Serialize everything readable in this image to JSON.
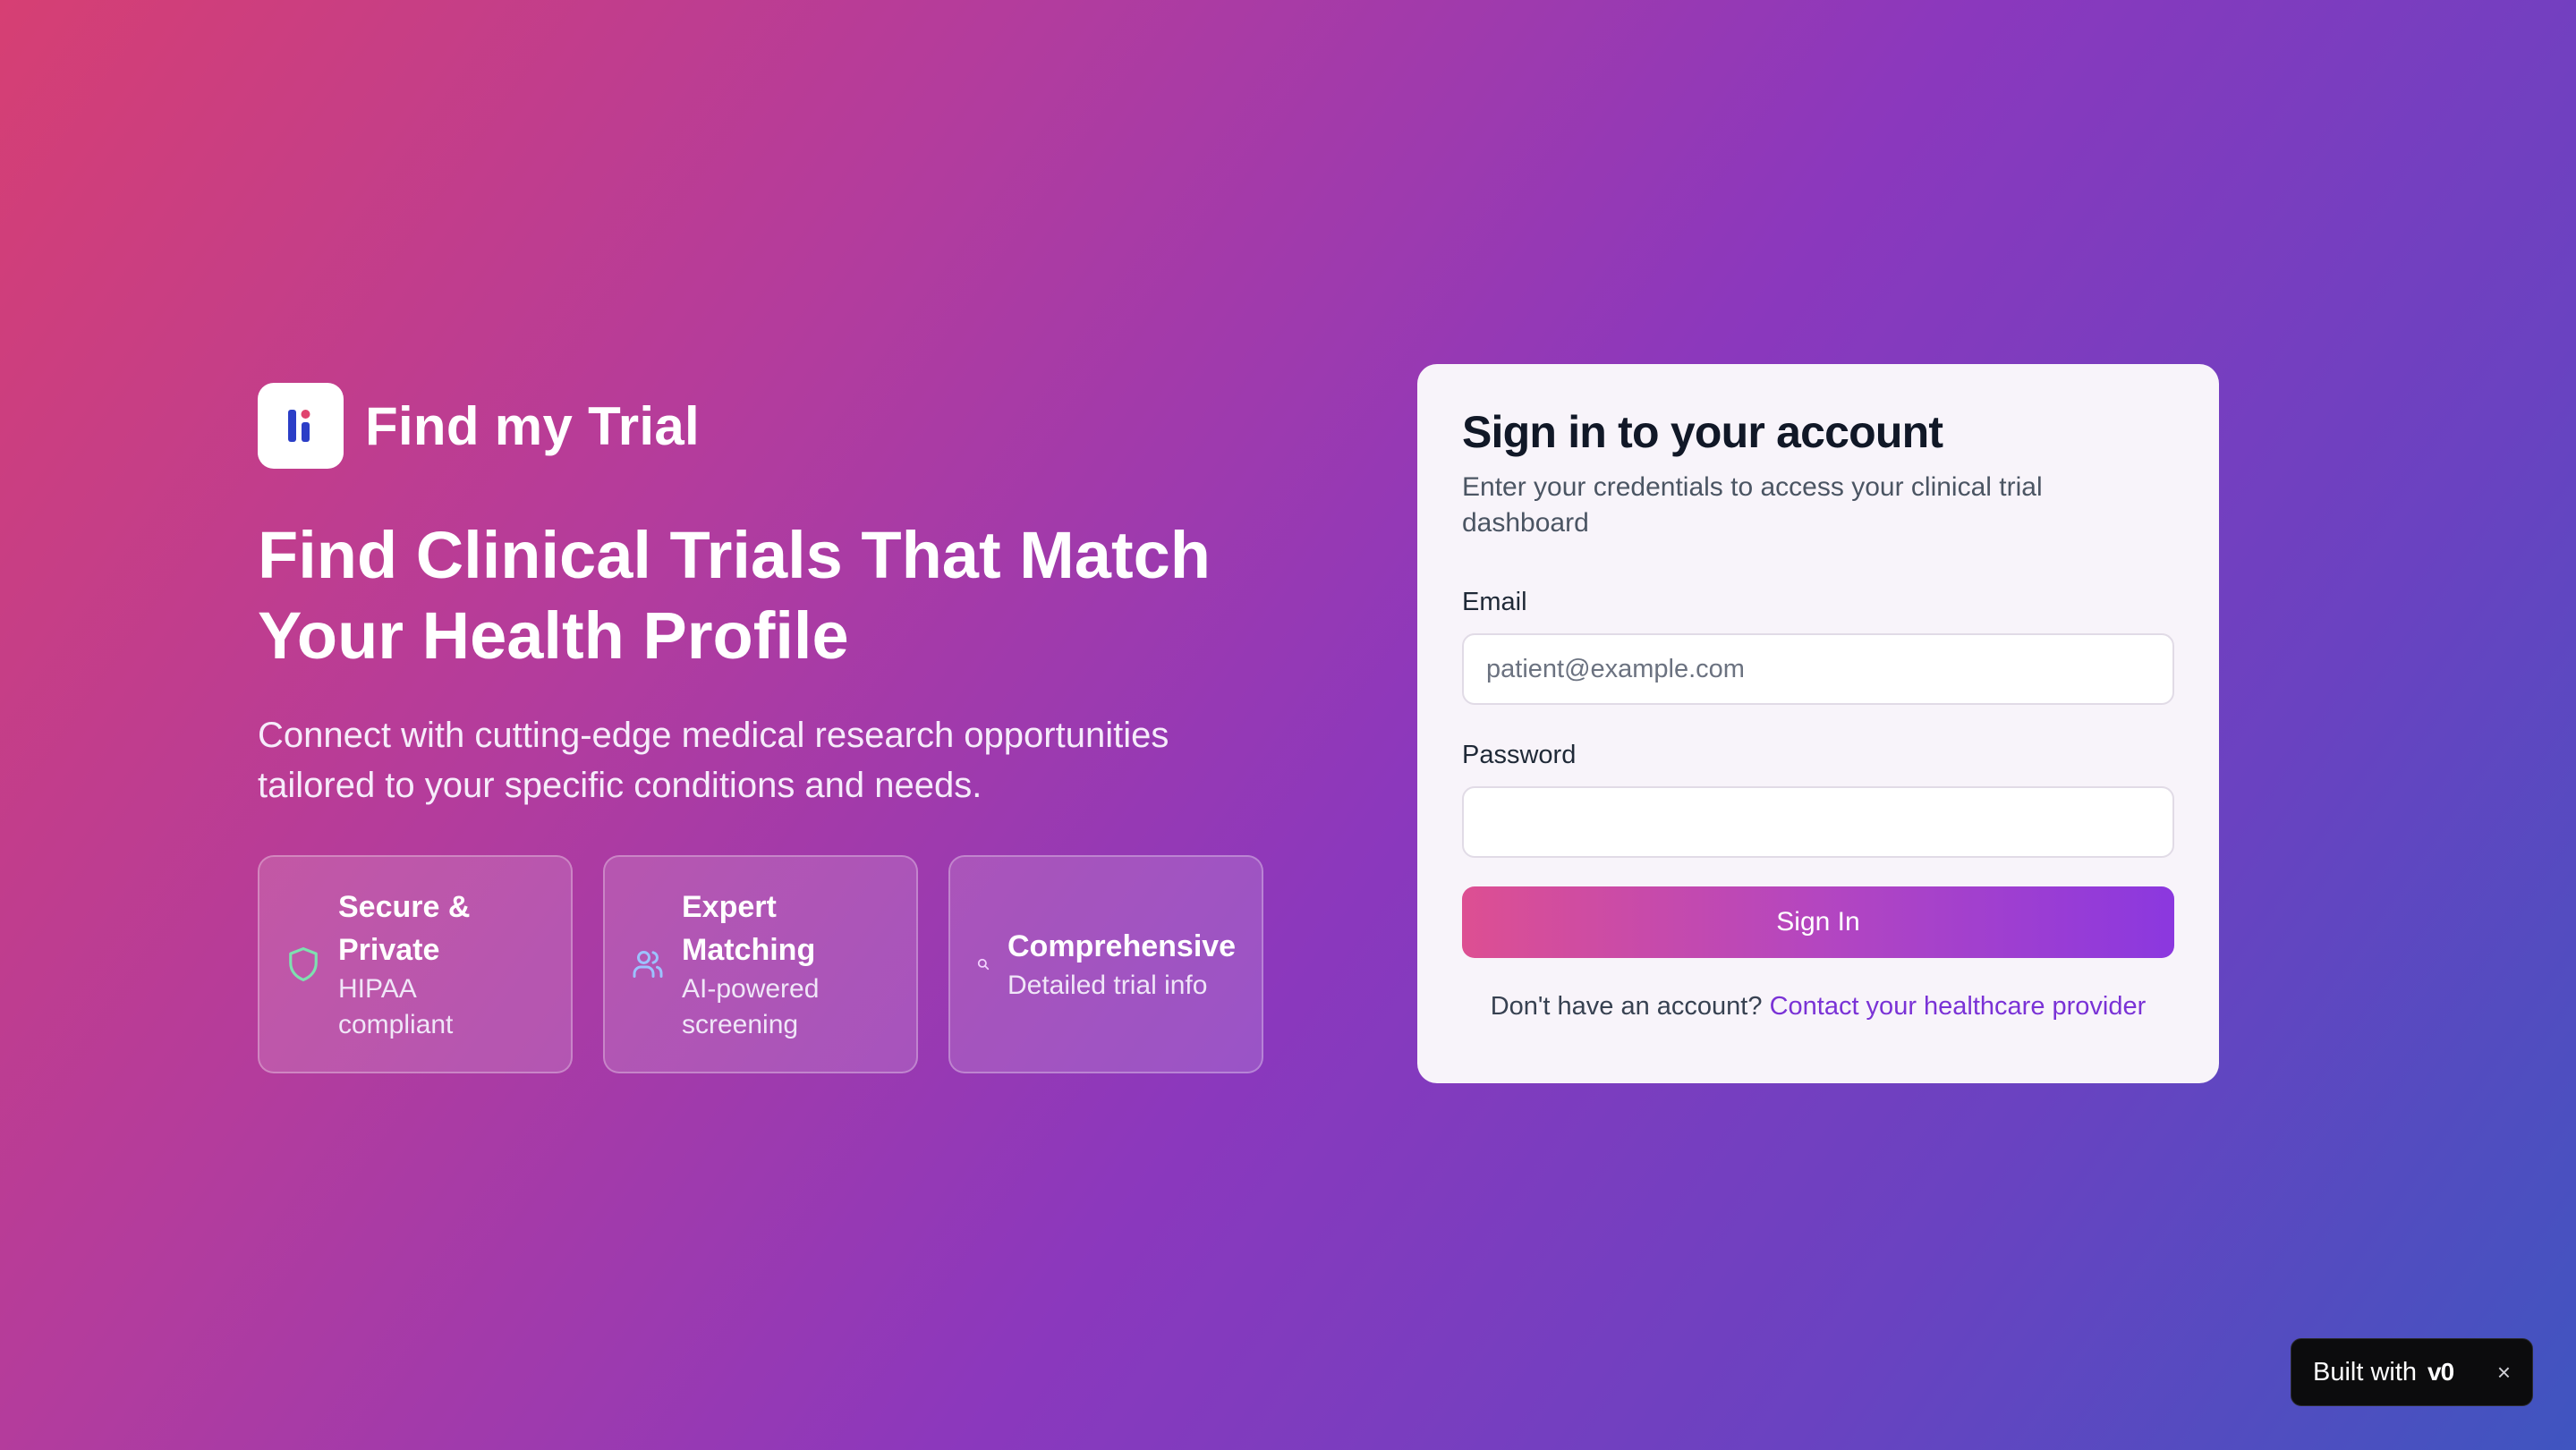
{
  "brand": {
    "name": "Find my Trial"
  },
  "hero": {
    "headline_line1": "Find Clinical Trials That Match",
    "headline_line2": "Your Health Profile",
    "subtext_line1": "Connect with cutting-edge medical research opportunities",
    "subtext_line2": "tailored to your specific conditions and needs."
  },
  "features": [
    {
      "icon": "shield-icon",
      "title_line1": "Secure &",
      "title_line2": "Private",
      "sub_line1": "HIPAA",
      "sub_line2": "compliant"
    },
    {
      "icon": "users-icon",
      "title_line1": "Expert",
      "title_line2": "Matching",
      "sub_line1": "AI-powered",
      "sub_line2": "screening"
    },
    {
      "icon": "search-icon",
      "title_line1": "Comprehensive",
      "sub_line1": "Detailed trial info"
    }
  ],
  "login": {
    "title": "Sign in to your account",
    "desc_line1": "Enter your credentials to access your clinical trial",
    "desc_line2": "dashboard",
    "email_label": "Email",
    "email_placeholder": "patient@example.com",
    "email_value": "",
    "password_label": "Password",
    "password_value": "",
    "submit_label": "Sign In",
    "footer_text": "Don't have an account?",
    "footer_link": "Contact your healthcare provider"
  },
  "badge": {
    "text": "Built with",
    "logo": "v0",
    "close": "×"
  },
  "colors": {
    "accent_purple": "#8b38df",
    "accent_pink": "#dd4f92",
    "link": "#7a32d6",
    "shield_green": "#7ee0b0",
    "users_blue": "#9cc2ff"
  }
}
